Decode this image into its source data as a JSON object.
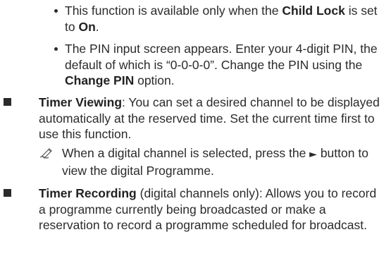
{
  "items": [
    {
      "kind": "dot",
      "parts": [
        {
          "t": "This function is available only when the "
        },
        {
          "t": "Child Lock",
          "b": true
        },
        {
          "t": " is set to "
        },
        {
          "t": "On",
          "b": true
        },
        {
          "t": "."
        }
      ]
    },
    {
      "kind": "dot",
      "parts": [
        {
          "t": "The PIN input screen appears. Enter your 4-digit PIN, the default of which is “0-0-0-0”. Change the PIN using the "
        },
        {
          "t": "Change PIN",
          "b": true
        },
        {
          "t": " option."
        }
      ]
    },
    {
      "kind": "square",
      "parts": [
        {
          "t": "Timer Viewing",
          "b": true
        },
        {
          "t": ": You can set a desired channel to be displayed automatically at the reserved time. Set the current time first to use this function."
        }
      ]
    },
    {
      "kind": "note",
      "icon": "pencil-note-icon",
      "parts": [
        {
          "t": "When a digital channel is selected, press the "
        },
        {
          "t": "►",
          "glyph": true
        },
        {
          "t": " button to view the digital Programme."
        }
      ]
    },
    {
      "kind": "square",
      "parts": [
        {
          "t": "Timer Recording",
          "b": true
        },
        {
          "t": " (digital channels only): Allows you to record a programme currently being broadcasted or make a reservation to record a programme scheduled for broadcast."
        }
      ]
    }
  ],
  "colors": {
    "text": "#2b2b2b"
  }
}
